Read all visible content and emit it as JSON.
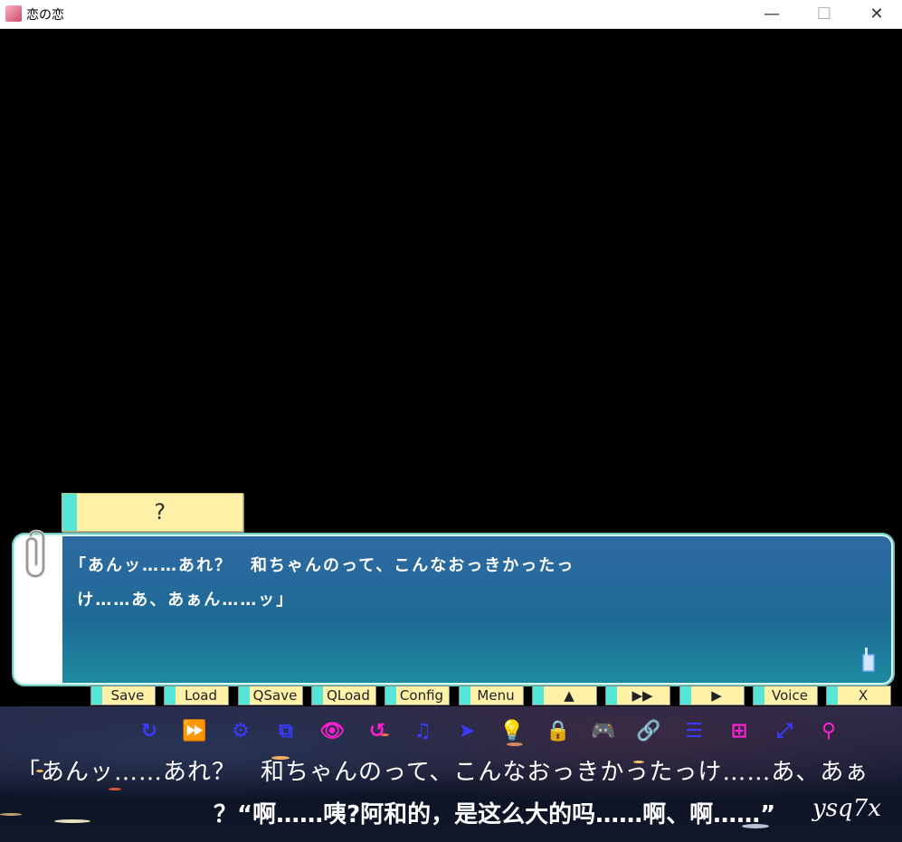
{
  "window": {
    "title": "恋の恋",
    "minimize": "—",
    "maximize": "☐",
    "close": "✕"
  },
  "namebox": {
    "name": "?"
  },
  "message": {
    "line1": "「あんッ……あれ？　和ちゃんのって、こんなおっきかったっ",
    "line2": " け……あ、あぁん……ッ」"
  },
  "buttons": [
    "Save",
    "Load",
    "QSave",
    "QLoad",
    "Config",
    "Menu",
    "▲",
    "▶▶",
    "▶",
    "Voice",
    "X"
  ],
  "toolbar_icons": [
    {
      "name": "refresh-icon",
      "glyph": "↻",
      "color": "#3b3bff"
    },
    {
      "name": "skip-icon",
      "glyph": "⏩",
      "color": "#ff1fd0"
    },
    {
      "name": "gear-icon",
      "glyph": "⚙",
      "color": "#3b3bff"
    },
    {
      "name": "copy-icon",
      "glyph": "⧉",
      "color": "#3b3bff"
    },
    {
      "name": "eye-icon",
      "glyph": "👁",
      "color": "#ff1fd0"
    },
    {
      "name": "undo-icon",
      "glyph": "↺",
      "color": "#ff1fd0"
    },
    {
      "name": "music-icon",
      "glyph": "♫",
      "color": "#3b3bff"
    },
    {
      "name": "pointer-icon",
      "glyph": "➤",
      "color": "#3b3bff"
    },
    {
      "name": "bulb-icon",
      "glyph": "💡",
      "color": "#3b3bff"
    },
    {
      "name": "lock-icon",
      "glyph": "🔒",
      "color": "#ff1fd0"
    },
    {
      "name": "gamepad-icon",
      "glyph": "🎮",
      "color": "#3b3bff"
    },
    {
      "name": "link-icon",
      "glyph": "🔗",
      "color": "#3b3bff"
    },
    {
      "name": "list-icon",
      "glyph": "☰",
      "color": "#3b3bff"
    },
    {
      "name": "windows-icon",
      "glyph": "⊞",
      "color": "#ff1fd0"
    },
    {
      "name": "expand-icon",
      "glyph": "⤢",
      "color": "#3b3bff"
    },
    {
      "name": "pin-icon",
      "glyph": "⚲",
      "color": "#ff1fd0"
    }
  ],
  "subtitles": {
    "japanese": "「あんッ……あれ？　和ちゃんのって、こんなおっきかったっけ……あ、あぁ",
    "chinese": "？“啊……咦?阿和的，是这么大的吗……啊、啊……”",
    "signature": "ysq7x"
  }
}
